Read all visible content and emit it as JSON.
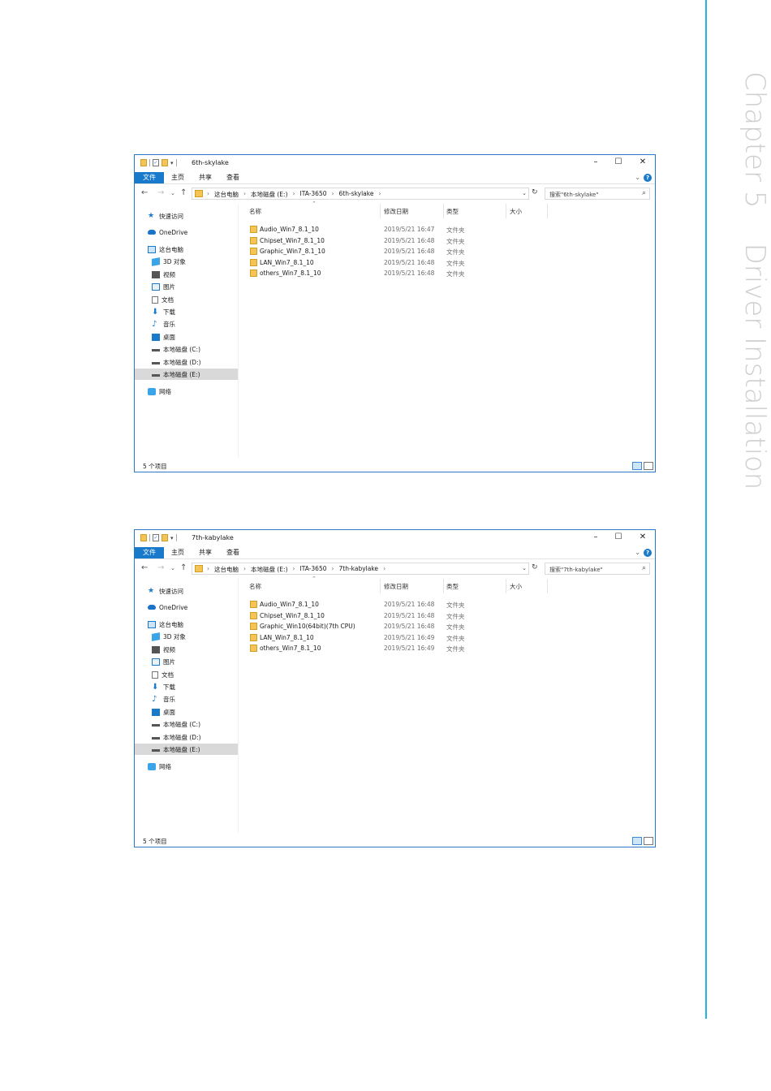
{
  "page": {
    "chapter_tab": "Chapter 5    Driver Installation"
  },
  "windows": [
    {
      "title": "6th-skylake",
      "ribbon_tabs": [
        "文件",
        "主页",
        "共享",
        "查看"
      ],
      "breadcrumb": [
        "这台电脑",
        "本地磁盘 (E:)",
        "ITA-3650",
        "6th-skylake"
      ],
      "search_placeholder": "搜索\"6th-skylake\"",
      "nav_items": [
        {
          "label": "快速访问",
          "icon": "star-icon"
        },
        {
          "label": "OneDrive",
          "icon": "cloud-icon"
        },
        {
          "label": "这台电脑",
          "icon": "computer-icon"
        },
        {
          "label": "3D 对象",
          "icon": "cube-icon"
        },
        {
          "label": "视频",
          "icon": "video-icon"
        },
        {
          "label": "图片",
          "icon": "picture-icon"
        },
        {
          "label": "文档",
          "icon": "document-icon"
        },
        {
          "label": "下载",
          "icon": "download-icon"
        },
        {
          "label": "音乐",
          "icon": "music-icon"
        },
        {
          "label": "桌面",
          "icon": "desktop-icon"
        },
        {
          "label": "本地磁盘 (C:)",
          "icon": "drive-icon"
        },
        {
          "label": "本地磁盘 (D:)",
          "icon": "drive-icon"
        },
        {
          "label": "本地磁盘 (E:)",
          "icon": "drive-icon",
          "selected": true
        },
        {
          "label": "网络",
          "icon": "network-icon"
        }
      ],
      "columns": [
        "名称",
        "修改日期",
        "类型",
        "大小"
      ],
      "files": [
        {
          "name": "Audio_Win7_8.1_10",
          "date": "2019/5/21 16:47",
          "type": "文件夹"
        },
        {
          "name": "Chipset_Win7_8.1_10",
          "date": "2019/5/21 16:48",
          "type": "文件夹"
        },
        {
          "name": "Graphic_Win7_8.1_10",
          "date": "2019/5/21 16:48",
          "type": "文件夹"
        },
        {
          "name": "LAN_Win7_8.1_10",
          "date": "2019/5/21 16:48",
          "type": "文件夹"
        },
        {
          "name": "others_Win7_8.1_10",
          "date": "2019/5/21 16:48",
          "type": "文件夹"
        }
      ],
      "status": "5 个项目"
    },
    {
      "title": "7th-kabylake",
      "ribbon_tabs": [
        "文件",
        "主页",
        "共享",
        "查看"
      ],
      "breadcrumb": [
        "这台电脑",
        "本地磁盘 (E:)",
        "ITA-3650",
        "7th-kabylake"
      ],
      "search_placeholder": "搜索\"7th-kabylake\"",
      "nav_items": [
        {
          "label": "快速访问",
          "icon": "star-icon"
        },
        {
          "label": "OneDrive",
          "icon": "cloud-icon"
        },
        {
          "label": "这台电脑",
          "icon": "computer-icon"
        },
        {
          "label": "3D 对象",
          "icon": "cube-icon"
        },
        {
          "label": "视频",
          "icon": "video-icon"
        },
        {
          "label": "图片",
          "icon": "picture-icon"
        },
        {
          "label": "文档",
          "icon": "document-icon"
        },
        {
          "label": "下载",
          "icon": "download-icon"
        },
        {
          "label": "音乐",
          "icon": "music-icon"
        },
        {
          "label": "桌面",
          "icon": "desktop-icon"
        },
        {
          "label": "本地磁盘 (C:)",
          "icon": "drive-icon"
        },
        {
          "label": "本地磁盘 (D:)",
          "icon": "drive-icon"
        },
        {
          "label": "本地磁盘 (E:)",
          "icon": "drive-icon",
          "selected": true
        },
        {
          "label": "网络",
          "icon": "network-icon"
        }
      ],
      "columns": [
        "名称",
        "修改日期",
        "类型",
        "大小"
      ],
      "files": [
        {
          "name": "Audio_Win7_8.1_10",
          "date": "2019/5/21 16:48",
          "type": "文件夹"
        },
        {
          "name": "Chipset_Win7_8.1_10",
          "date": "2019/5/21 16:48",
          "type": "文件夹"
        },
        {
          "name": "Graphic_Win10(64bit)(7th CPU)",
          "date": "2019/5/21 16:48",
          "type": "文件夹"
        },
        {
          "name": "LAN_Win7_8.1_10",
          "date": "2019/5/21 16:49",
          "type": "文件夹"
        },
        {
          "name": "others_Win7_8.1_10",
          "date": "2019/5/21 16:49",
          "type": "文件夹"
        }
      ],
      "status": "5 个项目"
    }
  ]
}
